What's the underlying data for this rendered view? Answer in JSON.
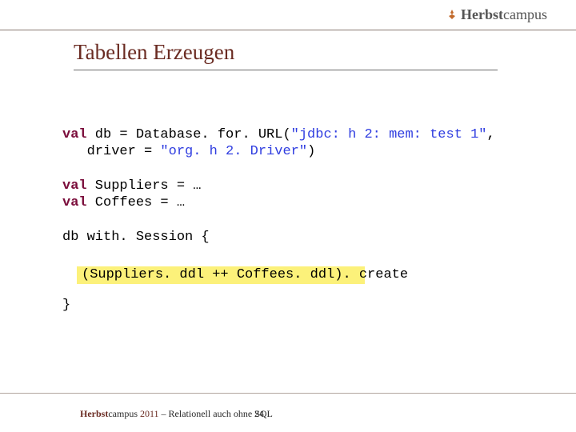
{
  "header": {
    "brand_first": "Herbst",
    "brand_last": "campus"
  },
  "title": "Tabellen Erzeugen",
  "code": {
    "line1a": "val",
    "line1b": " db = Database. for. URL(",
    "line1c": "\"jdbc: h 2: mem: test 1\"",
    "line1d": ",",
    "line2a": "   driver = ",
    "line2b": "\"org. h 2. Driver\"",
    "line2c": ")",
    "line4a": "val",
    "line4b": " Suppliers = …",
    "line5a": "val",
    "line5b": " Coffees = …",
    "line7": "db with. Session {",
    "highlight": "(Suppliers. ddl ++ Coffees. ddl). create",
    "line11": "}"
  },
  "footer": {
    "strong": "Herbst",
    "mid": "campus ",
    "year": "2011",
    "rest": " – Relationell auch ohne SQL",
    "page": "24"
  }
}
